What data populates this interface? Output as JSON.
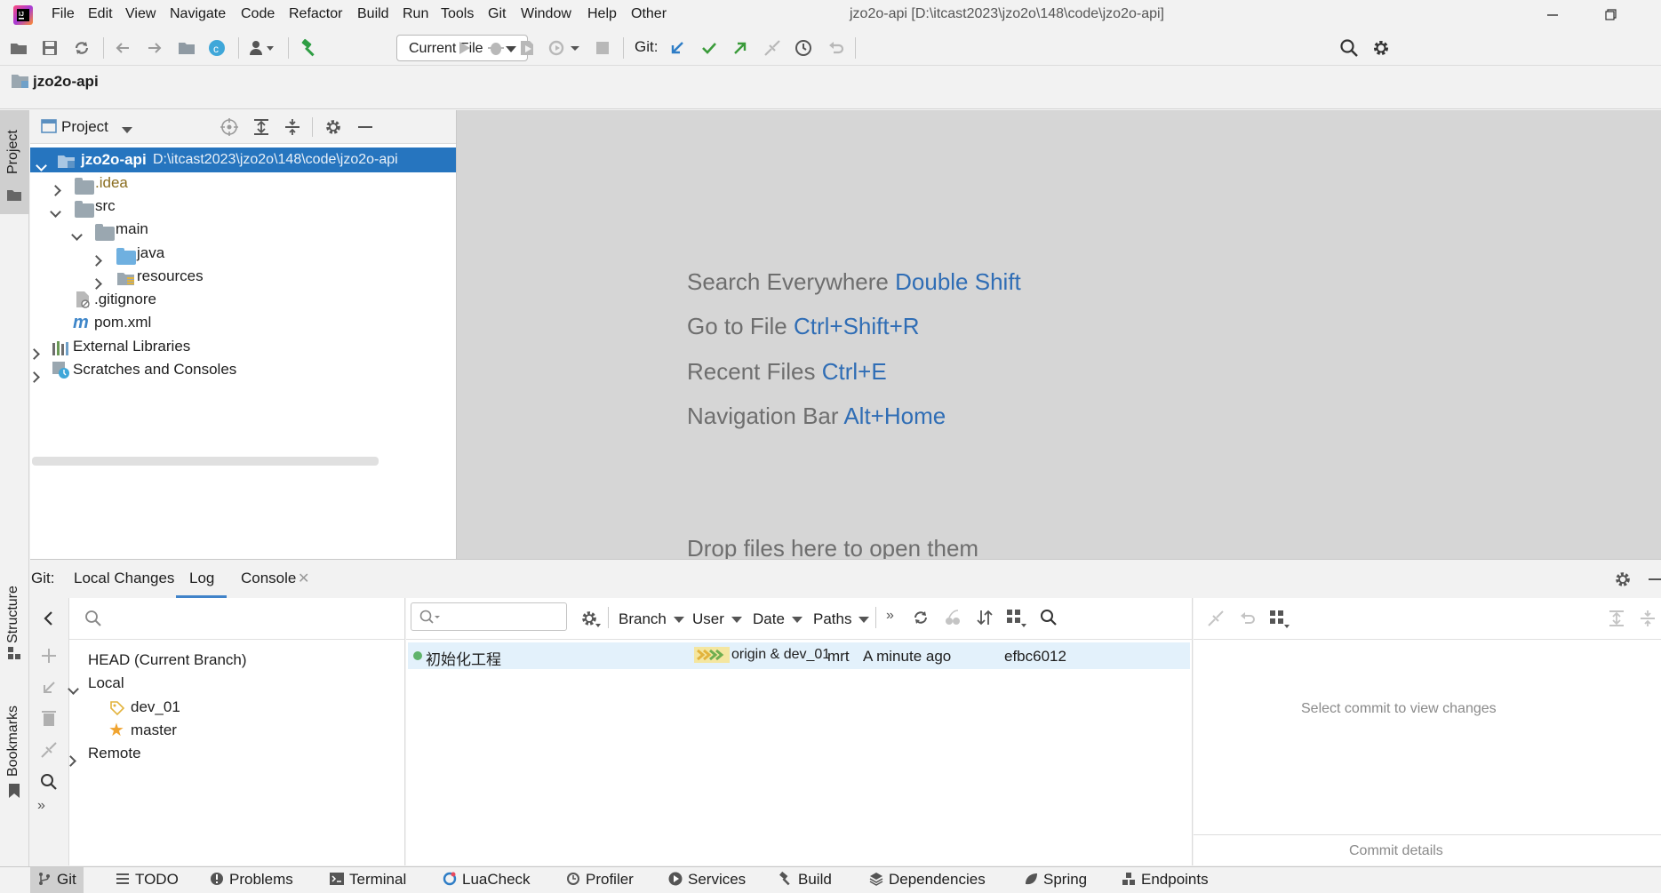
{
  "menubar": {
    "items": [
      "File",
      "Edit",
      "View",
      "Navigate",
      "Code",
      "Refactor",
      "Build",
      "Run",
      "Tools",
      "Git",
      "Window",
      "Help",
      "Other"
    ],
    "title": "jzo2o-api [D:\\itcast2023\\jzo2o\\148\\code\\jzo2o-api]"
  },
  "toolbar": {
    "run_config": "Current File",
    "git_label": "Git:"
  },
  "navbar": {
    "project_name": "jzo2o-api"
  },
  "stripe": {
    "project": "Project",
    "structure": "Structure",
    "bookmarks": "Bookmarks"
  },
  "project_panel": {
    "title": "Project",
    "tree": [
      {
        "name": "jzo2o-api",
        "path": "D:\\itcast2023\\jzo2o\\148\\code\\jzo2o-api"
      },
      {
        "name": ".idea"
      },
      {
        "name": "src"
      },
      {
        "name": "main"
      },
      {
        "name": "java"
      },
      {
        "name": "resources"
      },
      {
        "name": ".gitignore"
      },
      {
        "name": "pom.xml"
      },
      {
        "name": "External Libraries"
      },
      {
        "name": "Scratches and Consoles"
      }
    ]
  },
  "editor_hints": [
    {
      "text": "Search Everywhere",
      "key": "Double Shift"
    },
    {
      "text": "Go to File",
      "key": "Ctrl+Shift+R"
    },
    {
      "text": "Recent Files",
      "key": "Ctrl+E"
    },
    {
      "text": "Navigation Bar",
      "key": "Alt+Home"
    },
    {
      "text": "Drop files here to open them",
      "key": ""
    }
  ],
  "git_window": {
    "prefix": "Git:",
    "tabs": [
      "Local Changes",
      "Log",
      "Console"
    ],
    "active_tab": "Log",
    "branches": {
      "head": "HEAD (Current Branch)",
      "local": "Local",
      "local_branches": [
        "dev_01",
        "master"
      ],
      "remote": "Remote"
    },
    "filters": {
      "branch": "Branch",
      "user": "User",
      "date": "Date",
      "paths": "Paths"
    },
    "commits": [
      {
        "message": "初始化工程",
        "refs": "origin & dev_01",
        "author": "mrt",
        "date": "A minute ago",
        "hash": "efbc6012"
      }
    ],
    "details": {
      "placeholder": "Select commit to view changes",
      "footer": "Commit details"
    }
  },
  "bottom_bar": {
    "items": [
      "Git",
      "TODO",
      "Problems",
      "Terminal",
      "LuaCheck",
      "Profiler",
      "Services",
      "Build",
      "Dependencies",
      "Spring",
      "Endpoints"
    ]
  },
  "colors": {
    "selection": "#2675bf",
    "link_key": "#2f6db5",
    "commit_row": "#e3f1fb",
    "green": "#3a9b3a",
    "blue": "#2e7dc6"
  }
}
